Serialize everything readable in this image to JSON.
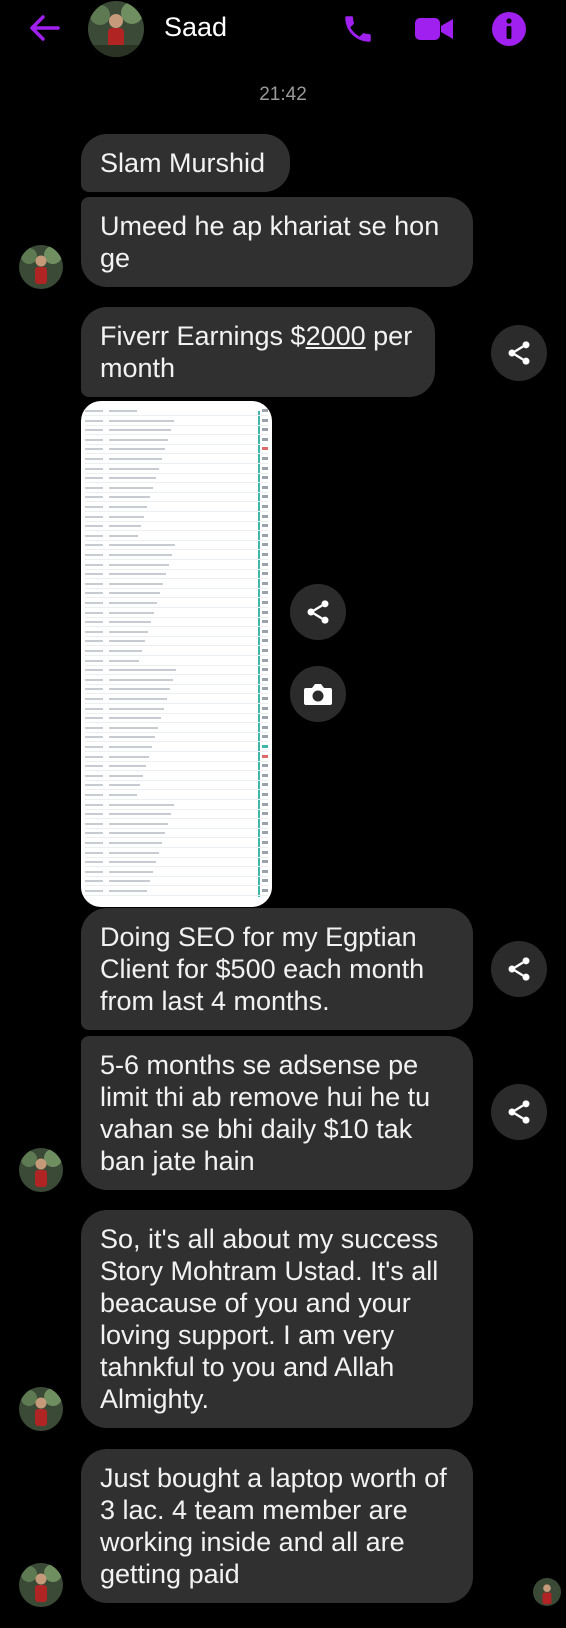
{
  "header": {
    "contact_name": "Saad",
    "icons": [
      "back-arrow-icon",
      "phone-icon",
      "video-camera-icon",
      "info-icon"
    ],
    "accent_color": "#a020f0"
  },
  "thread": {
    "timestamp": "21:42",
    "messages": [
      {
        "text": "Slam Murshid"
      },
      {
        "text": "Umeed he ap khariat se hon ge"
      },
      {
        "text_pre": "Fiverr Earnings $",
        "text_underlined": "2000",
        "text_post": " per month"
      },
      {
        "attachment": "image-screenshot"
      },
      {
        "text": "Doing SEO for my Egptian Client for $500 each month from last 4 months."
      },
      {
        "text": "5-6 months se adsense pe limit thi ab remove hui he tu vahan se bhi daily $10 tak ban jate hain"
      },
      {
        "text": "So, it's all about my success Story Mohtram Ustad. It's all beacause of you and your loving support. I am very tahnkful to you and Allah Almighty."
      },
      {
        "text": "Just bought a laptop worth of 3 lac. 4 team member are working inside and all are getting paid"
      }
    ]
  },
  "colors": {
    "background": "#000000",
    "bubble": "#303030",
    "share_button": "#2b2b2b",
    "timestamp": "#9a9a9a"
  }
}
